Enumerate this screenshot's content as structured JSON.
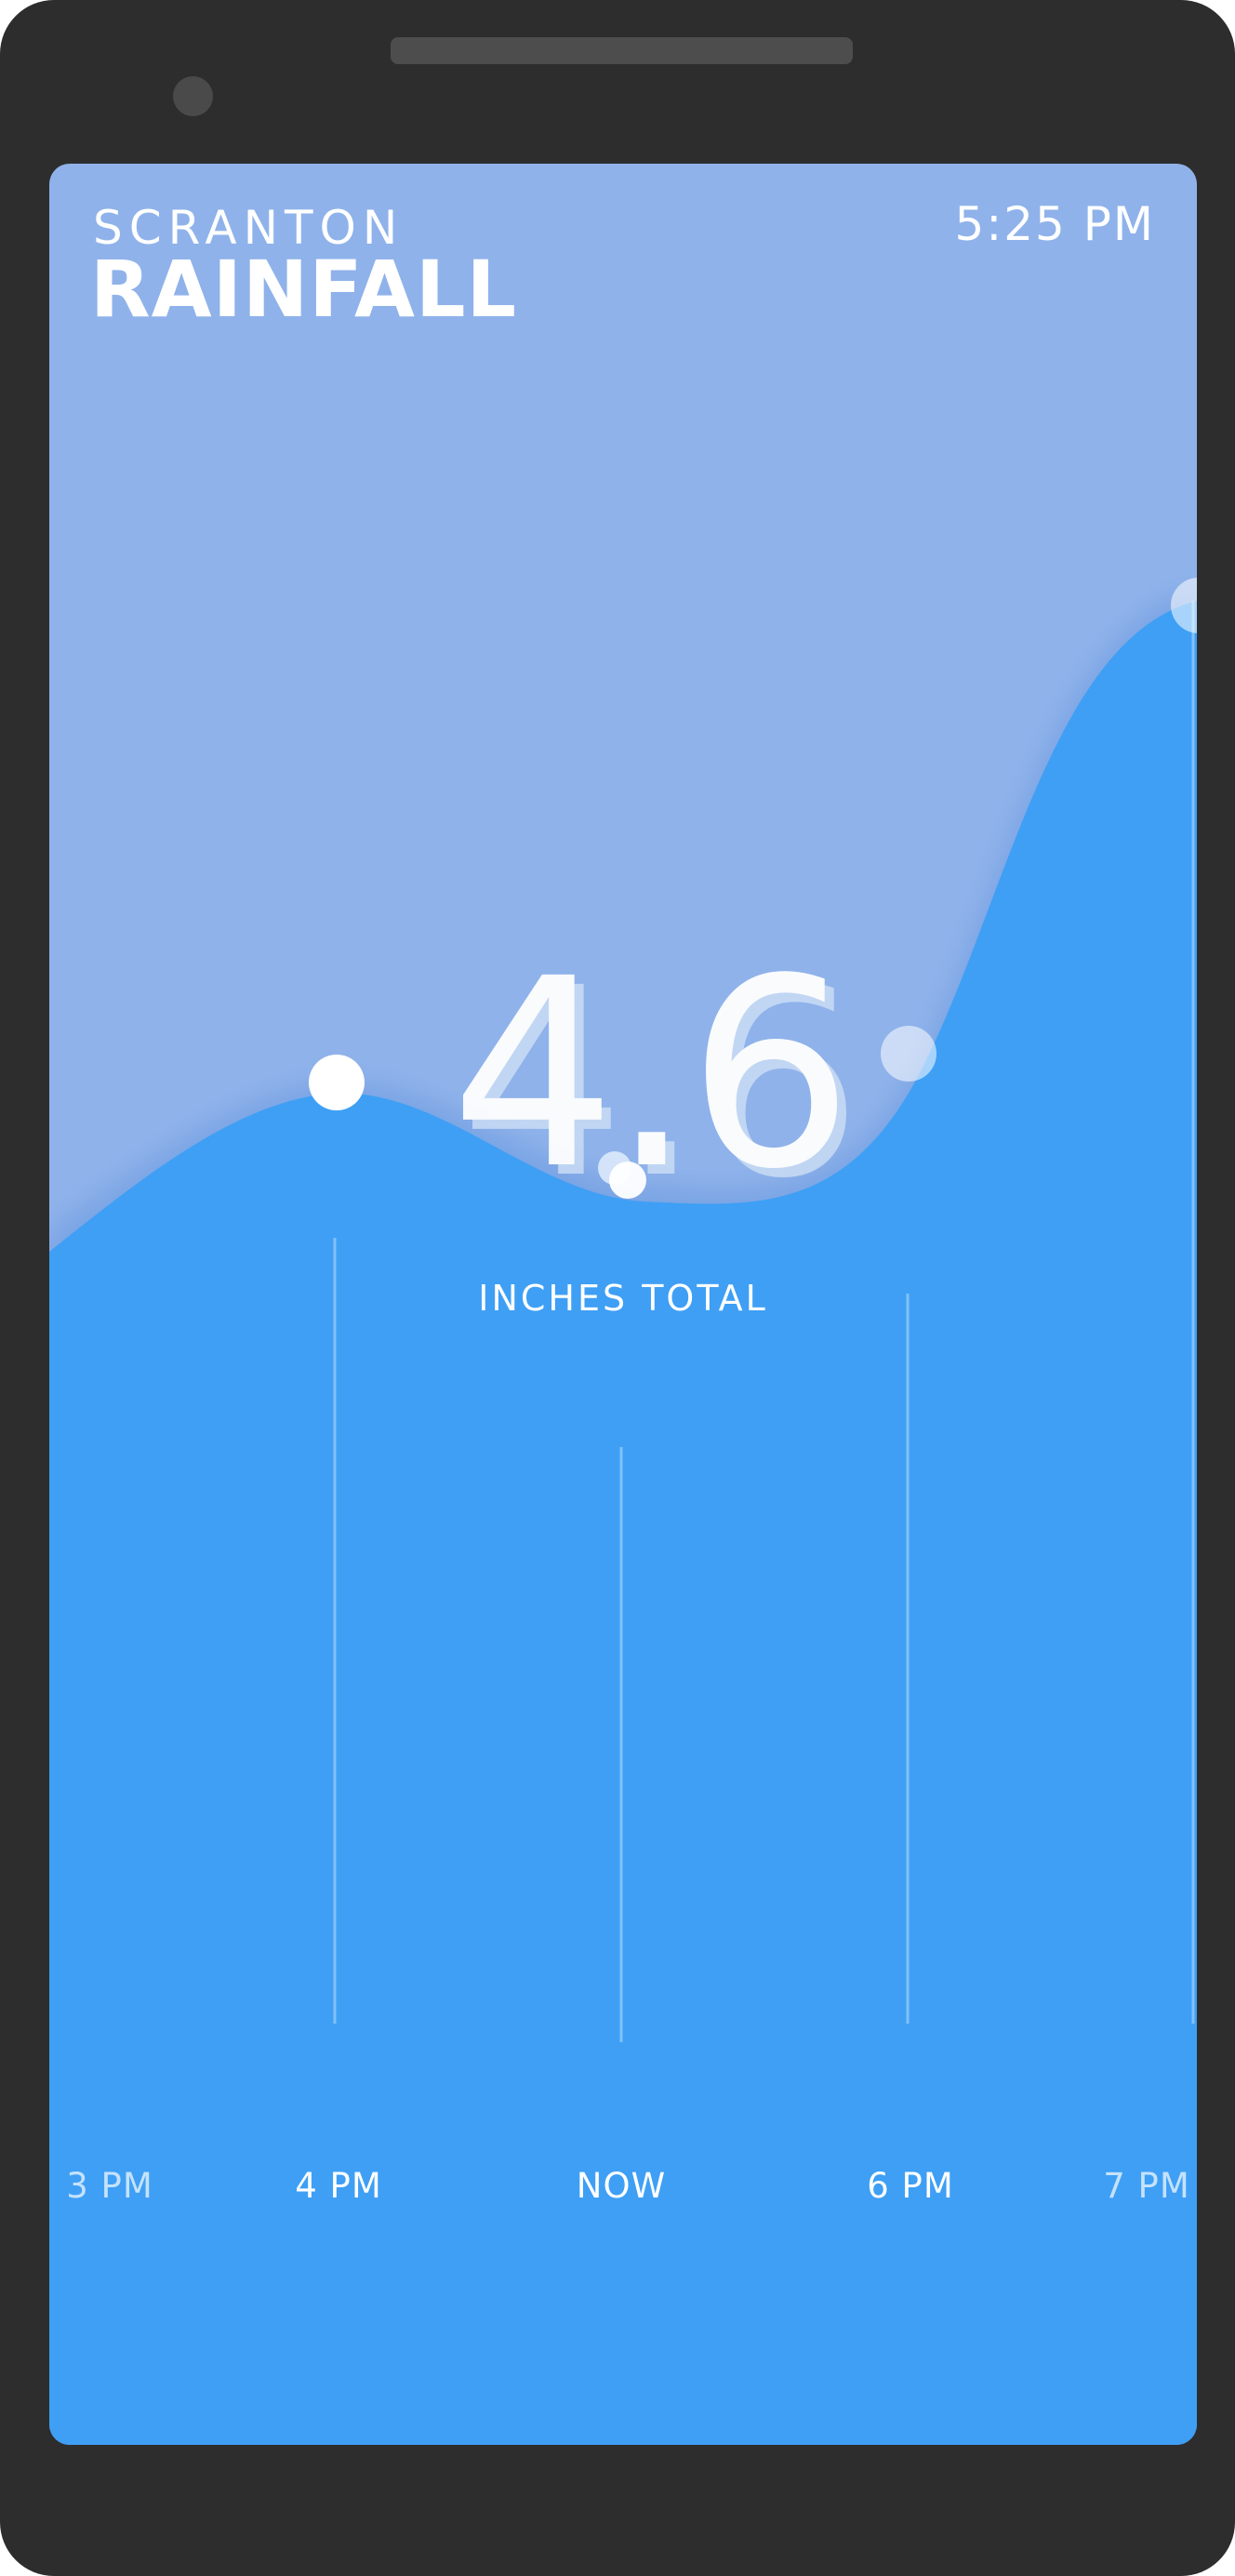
{
  "header": {
    "city": "SCRANTON",
    "title": "RAINFALL",
    "time": "5:25 PM"
  },
  "summary": {
    "total_value": "4.6",
    "total_label": "INCHES TOTAL"
  },
  "timeline": {
    "labels": [
      "3 PM",
      "4 PM",
      "NOW",
      "6 PM",
      "7 PM"
    ]
  },
  "colors": {
    "device_frame": "#2d2d2d",
    "sky": "#8fb2ea",
    "rain_fill": "#3e9ff5",
    "text": "#ffffff"
  }
}
